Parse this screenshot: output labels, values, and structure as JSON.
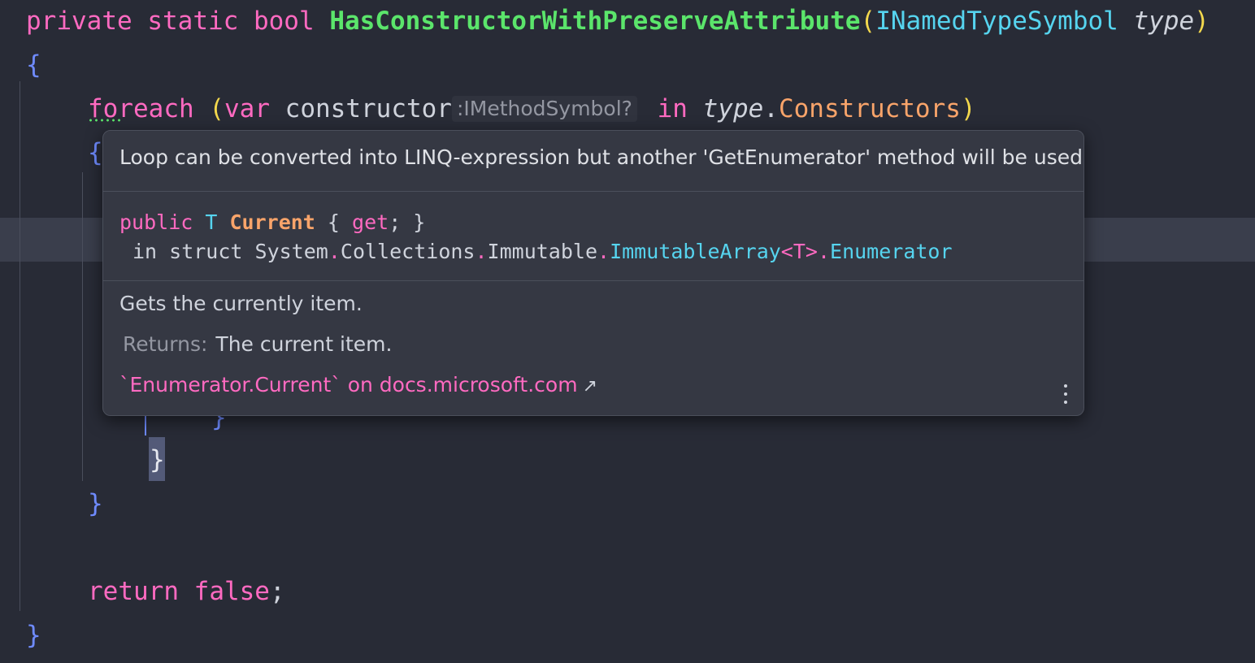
{
  "editor": {
    "line1": {
      "kw_private": "private",
      "kw_static": "static",
      "kw_bool": "bool",
      "method_name": "HasConstructorWithPreserveAttribute",
      "open_paren": "(",
      "param_type": "INamedTypeSymbol",
      "param_name": "type",
      "close_paren": ")"
    },
    "open_brace_method": "{",
    "foreach_line": {
      "kw_foreach": "foreach",
      "open_paren": "(",
      "kw_var": "var",
      "var_name": "constructor",
      "type_hint": ":IMethodSymbol?",
      "kw_in": "in",
      "obj": "type",
      "dot": ".",
      "member": "Constructors",
      "close_paren": ")"
    },
    "open_brace_loop": "{",
    "inner_close_brace": "}",
    "loop_close_brace": "}",
    "foreach_close_brace": "}",
    "return_line": {
      "kw_return": "return",
      "value": "false",
      "semicolon": ";"
    },
    "method_close_brace": "}"
  },
  "popup": {
    "inspection_message": "Loop can be converted into LINQ-expression but another 'GetEnumerator' method will be used",
    "signature": {
      "kw_public": "public",
      "type_param": "T",
      "prop_name": "Current",
      "open": "{",
      "kw_get": "get",
      "close": "; }",
      "in_struct": "in struct",
      "ns1": "System",
      "ns2": "Collections",
      "ns3": "Immutable",
      "type_name": "ImmutableArray",
      "generic": "<T>",
      "nested": "Enumerator",
      "dot": "."
    },
    "description": "Gets the currently item.",
    "returns_label": "Returns:",
    "returns_value": "The current item.",
    "doc_link": "`Enumerator.Current` on docs.microsoft.com",
    "external_icon": "external-link-icon",
    "more_icon": "more-vertical-icon"
  },
  "colors": {
    "background": "#282b36",
    "keyword": "#ff6ac1",
    "method": "#5be56b",
    "type": "#56d4ef",
    "property": "#f9a46a",
    "popup_background": "#353843"
  }
}
